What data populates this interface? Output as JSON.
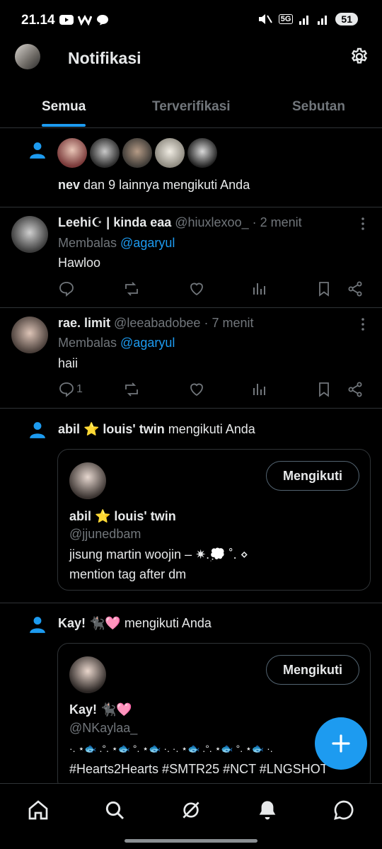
{
  "status_bar": {
    "time": "21.14",
    "battery": "51",
    "network": "5G"
  },
  "header": {
    "title": "Notifikasi"
  },
  "tabs": [
    {
      "label": "Semua",
      "active": true
    },
    {
      "label": "Terverifikasi",
      "active": false
    },
    {
      "label": "Sebutan",
      "active": false
    }
  ],
  "follow_group": {
    "name": "nev",
    "text": " dan 9 lainnya mengikuti Anda"
  },
  "replies": [
    {
      "display_name": "Leehi☪︎ | kinda eaa",
      "handle": "@hiuxlexoo_",
      "time": "· 2 menit",
      "replying_label": "Membalas",
      "replying_to": "@agaryul",
      "text": "Hawloo",
      "reply_count": ""
    },
    {
      "display_name": "rae. limit",
      "handle": "@leeabadobee",
      "time": "· 7 menit",
      "replying_label": "Membalas",
      "replying_to": "@agaryul",
      "text": "haii",
      "reply_count": "1"
    }
  ],
  "follows": [
    {
      "name": "abil ⭐ louis' twin",
      "action": " mengikuti Anda",
      "button": "Mengikuti",
      "handle": "@jjunedbam",
      "bio_line1": "jisung martin woojin –  ✷.💭 ˚. ⋄",
      "bio_line2": "mention tag after dm"
    },
    {
      "name": "Kay! 🐈‍⬛🩷",
      "action": " mengikuti Anda",
      "button": "Mengikuti",
      "handle": "@NKaylaa_",
      "bio_line1": "·. ⋆🐟 .°. ⋆🐟 °. ⋆🐟 ·. ·. ⋆🐟 .°. ⋆🐟 °. ⋆🐟 ·.",
      "bio_line2": "#Hearts2Hearts #SMTR25 #NCT #LNGSHOT"
    }
  ],
  "colors": {
    "accent": "#1d9bf0",
    "background": "#000000",
    "text": "#e7e9ea",
    "muted": "#71767b"
  }
}
